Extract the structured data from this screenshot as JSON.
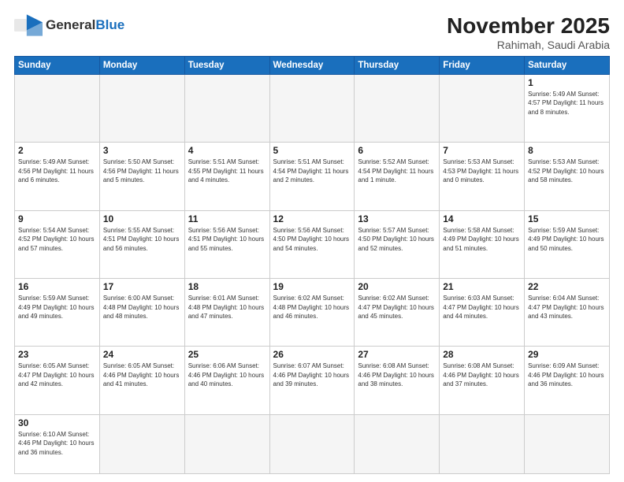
{
  "header": {
    "logo_general": "General",
    "logo_blue": "Blue",
    "month_title": "November 2025",
    "location": "Rahimah, Saudi Arabia"
  },
  "days_of_week": [
    "Sunday",
    "Monday",
    "Tuesday",
    "Wednesday",
    "Thursday",
    "Friday",
    "Saturday"
  ],
  "weeks": [
    [
      {
        "day": "",
        "info": ""
      },
      {
        "day": "",
        "info": ""
      },
      {
        "day": "",
        "info": ""
      },
      {
        "day": "",
        "info": ""
      },
      {
        "day": "",
        "info": ""
      },
      {
        "day": "",
        "info": ""
      },
      {
        "day": "1",
        "info": "Sunrise: 5:49 AM\nSunset: 4:57 PM\nDaylight: 11 hours\nand 8 minutes."
      }
    ],
    [
      {
        "day": "2",
        "info": "Sunrise: 5:49 AM\nSunset: 4:56 PM\nDaylight: 11 hours\nand 6 minutes."
      },
      {
        "day": "3",
        "info": "Sunrise: 5:50 AM\nSunset: 4:56 PM\nDaylight: 11 hours\nand 5 minutes."
      },
      {
        "day": "4",
        "info": "Sunrise: 5:51 AM\nSunset: 4:55 PM\nDaylight: 11 hours\nand 4 minutes."
      },
      {
        "day": "5",
        "info": "Sunrise: 5:51 AM\nSunset: 4:54 PM\nDaylight: 11 hours\nand 2 minutes."
      },
      {
        "day": "6",
        "info": "Sunrise: 5:52 AM\nSunset: 4:54 PM\nDaylight: 11 hours\nand 1 minute."
      },
      {
        "day": "7",
        "info": "Sunrise: 5:53 AM\nSunset: 4:53 PM\nDaylight: 11 hours\nand 0 minutes."
      },
      {
        "day": "8",
        "info": "Sunrise: 5:53 AM\nSunset: 4:52 PM\nDaylight: 10 hours\nand 58 minutes."
      }
    ],
    [
      {
        "day": "9",
        "info": "Sunrise: 5:54 AM\nSunset: 4:52 PM\nDaylight: 10 hours\nand 57 minutes."
      },
      {
        "day": "10",
        "info": "Sunrise: 5:55 AM\nSunset: 4:51 PM\nDaylight: 10 hours\nand 56 minutes."
      },
      {
        "day": "11",
        "info": "Sunrise: 5:56 AM\nSunset: 4:51 PM\nDaylight: 10 hours\nand 55 minutes."
      },
      {
        "day": "12",
        "info": "Sunrise: 5:56 AM\nSunset: 4:50 PM\nDaylight: 10 hours\nand 54 minutes."
      },
      {
        "day": "13",
        "info": "Sunrise: 5:57 AM\nSunset: 4:50 PM\nDaylight: 10 hours\nand 52 minutes."
      },
      {
        "day": "14",
        "info": "Sunrise: 5:58 AM\nSunset: 4:49 PM\nDaylight: 10 hours\nand 51 minutes."
      },
      {
        "day": "15",
        "info": "Sunrise: 5:59 AM\nSunset: 4:49 PM\nDaylight: 10 hours\nand 50 minutes."
      }
    ],
    [
      {
        "day": "16",
        "info": "Sunrise: 5:59 AM\nSunset: 4:49 PM\nDaylight: 10 hours\nand 49 minutes."
      },
      {
        "day": "17",
        "info": "Sunrise: 6:00 AM\nSunset: 4:48 PM\nDaylight: 10 hours\nand 48 minutes."
      },
      {
        "day": "18",
        "info": "Sunrise: 6:01 AM\nSunset: 4:48 PM\nDaylight: 10 hours\nand 47 minutes."
      },
      {
        "day": "19",
        "info": "Sunrise: 6:02 AM\nSunset: 4:48 PM\nDaylight: 10 hours\nand 46 minutes."
      },
      {
        "day": "20",
        "info": "Sunrise: 6:02 AM\nSunset: 4:47 PM\nDaylight: 10 hours\nand 45 minutes."
      },
      {
        "day": "21",
        "info": "Sunrise: 6:03 AM\nSunset: 4:47 PM\nDaylight: 10 hours\nand 44 minutes."
      },
      {
        "day": "22",
        "info": "Sunrise: 6:04 AM\nSunset: 4:47 PM\nDaylight: 10 hours\nand 43 minutes."
      }
    ],
    [
      {
        "day": "23",
        "info": "Sunrise: 6:05 AM\nSunset: 4:47 PM\nDaylight: 10 hours\nand 42 minutes."
      },
      {
        "day": "24",
        "info": "Sunrise: 6:05 AM\nSunset: 4:46 PM\nDaylight: 10 hours\nand 41 minutes."
      },
      {
        "day": "25",
        "info": "Sunrise: 6:06 AM\nSunset: 4:46 PM\nDaylight: 10 hours\nand 40 minutes."
      },
      {
        "day": "26",
        "info": "Sunrise: 6:07 AM\nSunset: 4:46 PM\nDaylight: 10 hours\nand 39 minutes."
      },
      {
        "day": "27",
        "info": "Sunrise: 6:08 AM\nSunset: 4:46 PM\nDaylight: 10 hours\nand 38 minutes."
      },
      {
        "day": "28",
        "info": "Sunrise: 6:08 AM\nSunset: 4:46 PM\nDaylight: 10 hours\nand 37 minutes."
      },
      {
        "day": "29",
        "info": "Sunrise: 6:09 AM\nSunset: 4:46 PM\nDaylight: 10 hours\nand 36 minutes."
      }
    ],
    [
      {
        "day": "30",
        "info": "Sunrise: 6:10 AM\nSunset: 4:46 PM\nDaylight: 10 hours\nand 36 minutes."
      },
      {
        "day": "",
        "info": ""
      },
      {
        "day": "",
        "info": ""
      },
      {
        "day": "",
        "info": ""
      },
      {
        "day": "",
        "info": ""
      },
      {
        "day": "",
        "info": ""
      },
      {
        "day": "",
        "info": ""
      }
    ]
  ]
}
